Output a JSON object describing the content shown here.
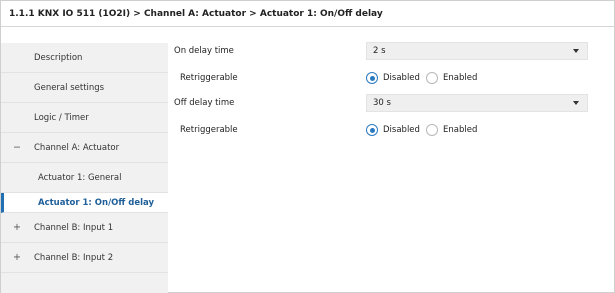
{
  "breadcrumb": "1.1.1 KNX IO 511 (1O2I) > Channel A: Actuator > Actuator 1: On/Off delay",
  "sidebar": {
    "items": [
      {
        "label": "Description",
        "expander": "",
        "active": false
      },
      {
        "label": "General settings",
        "expander": "",
        "active": false
      },
      {
        "label": "Logic / Timer",
        "expander": "",
        "active": false
      },
      {
        "label": "Channel A: Actuator",
        "expander": "−",
        "active": false
      },
      {
        "label": "Actuator 1: General",
        "expander": "",
        "active": false
      },
      {
        "label": "Actuator 1: On/Off delay",
        "expander": "",
        "active": true
      },
      {
        "label": "Channel B: Input 1",
        "expander": "+",
        "active": false
      },
      {
        "label": "Channel B: Input 2",
        "expander": "+",
        "active": false
      }
    ]
  },
  "params": {
    "on_delay": {
      "label": "On delay time",
      "value": "2 s"
    },
    "on_retrig": {
      "label": "Retriggerable",
      "options": [
        "Disabled",
        "Enabled"
      ],
      "selected": "Disabled"
    },
    "off_delay": {
      "label": "Off delay time",
      "value": "30 s"
    },
    "off_retrig": {
      "label": "Retriggerable",
      "options": [
        "Disabled",
        "Enabled"
      ],
      "selected": "Disabled"
    }
  },
  "icons": {
    "dropdown": "chevron-down-icon",
    "collapse": "minus-icon",
    "expand": "plus-icon"
  },
  "colors": {
    "accent": "#2a7ac0",
    "active_text": "#1f5f99",
    "sidebar_bg": "#f1f1f1",
    "field_bg": "#efefef"
  }
}
